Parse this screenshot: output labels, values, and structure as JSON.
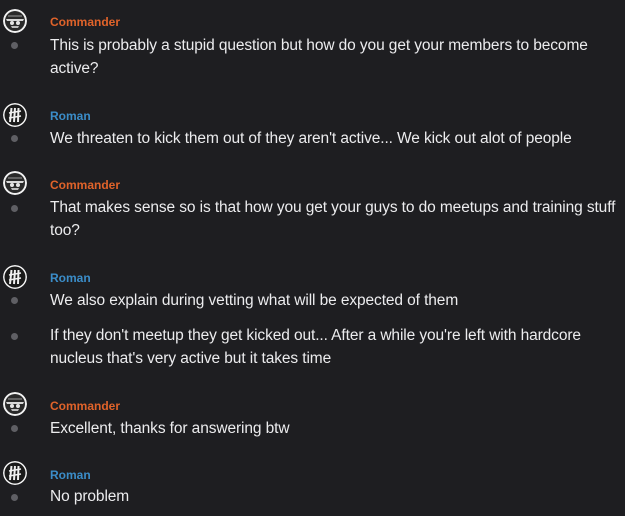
{
  "colors": {
    "background": "#1e1e21",
    "commander": "#e0632a",
    "roman": "#3b8dc9",
    "message_text": "#ececee",
    "bullet": "#5f5f64"
  },
  "users": {
    "commander": {
      "name": "Commander",
      "avatar_icon": "skull-emblem-icon"
    },
    "roman": {
      "name": "Roman",
      "avatar_icon": "hashtag-emblem-icon"
    }
  },
  "messages": [
    {
      "user": "Commander",
      "text": "This is probably a stupid question but how do you get your members to become active?"
    },
    {
      "user": "Roman",
      "text": "We threaten to kick them out of they aren't active... We kick out alot of people"
    },
    {
      "user": "Commander",
      "text": "That makes sense so is that how you get your guys to do meetups and training stuff too?"
    },
    {
      "user": "Roman",
      "text": "We also explain during vetting what will be expected of them"
    },
    {
      "user": "Roman",
      "text": "If they don't meetup they get kicked out... After a while you're left with hardcore nucleus that's very active but it takes time"
    },
    {
      "user": "Commander",
      "text": "Excellent, thanks for answering btw"
    },
    {
      "user": "Roman",
      "text": "No problem"
    }
  ]
}
